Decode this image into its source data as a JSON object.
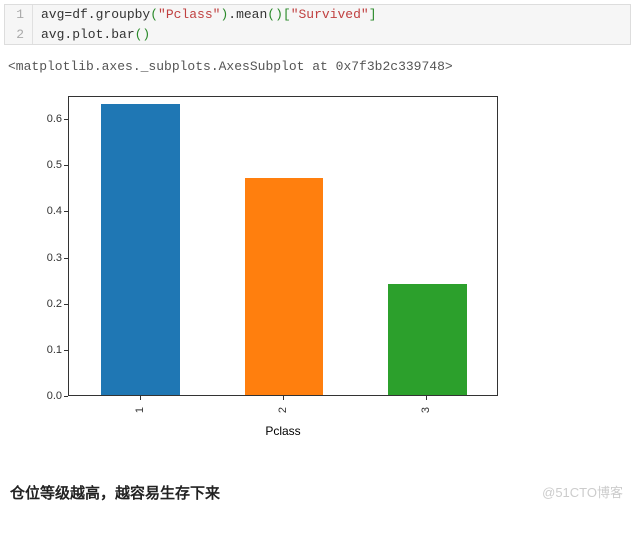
{
  "code": {
    "lines": [
      {
        "n": "1",
        "seg": [
          "avg=df.groupby",
          "(",
          "\"Pclass\"",
          ")",
          ".mean",
          "()[",
          "\"Survived\"",
          "]"
        ]
      },
      {
        "n": "2",
        "seg": [
          "avg.plot.bar",
          "()"
        ]
      }
    ]
  },
  "output_line": "<matplotlib.axes._subplots.AxesSubplot at 0x7f3b2c339748>",
  "chart_data": {
    "type": "bar",
    "categories": [
      "1",
      "2",
      "3"
    ],
    "values": [
      0.63,
      0.47,
      0.24
    ],
    "xlabel": "Pclass",
    "ylabel": "",
    "ylim": [
      0.0,
      0.65
    ],
    "yticks": [
      0.0,
      0.1,
      0.2,
      0.3,
      0.4,
      0.5,
      0.6
    ],
    "colors": [
      "#1f77b4",
      "#ff7f0e",
      "#2ca02c"
    ],
    "title": ""
  },
  "caption": "仓位等级越高，越容易生存下来",
  "watermark": "@51CTO博客"
}
